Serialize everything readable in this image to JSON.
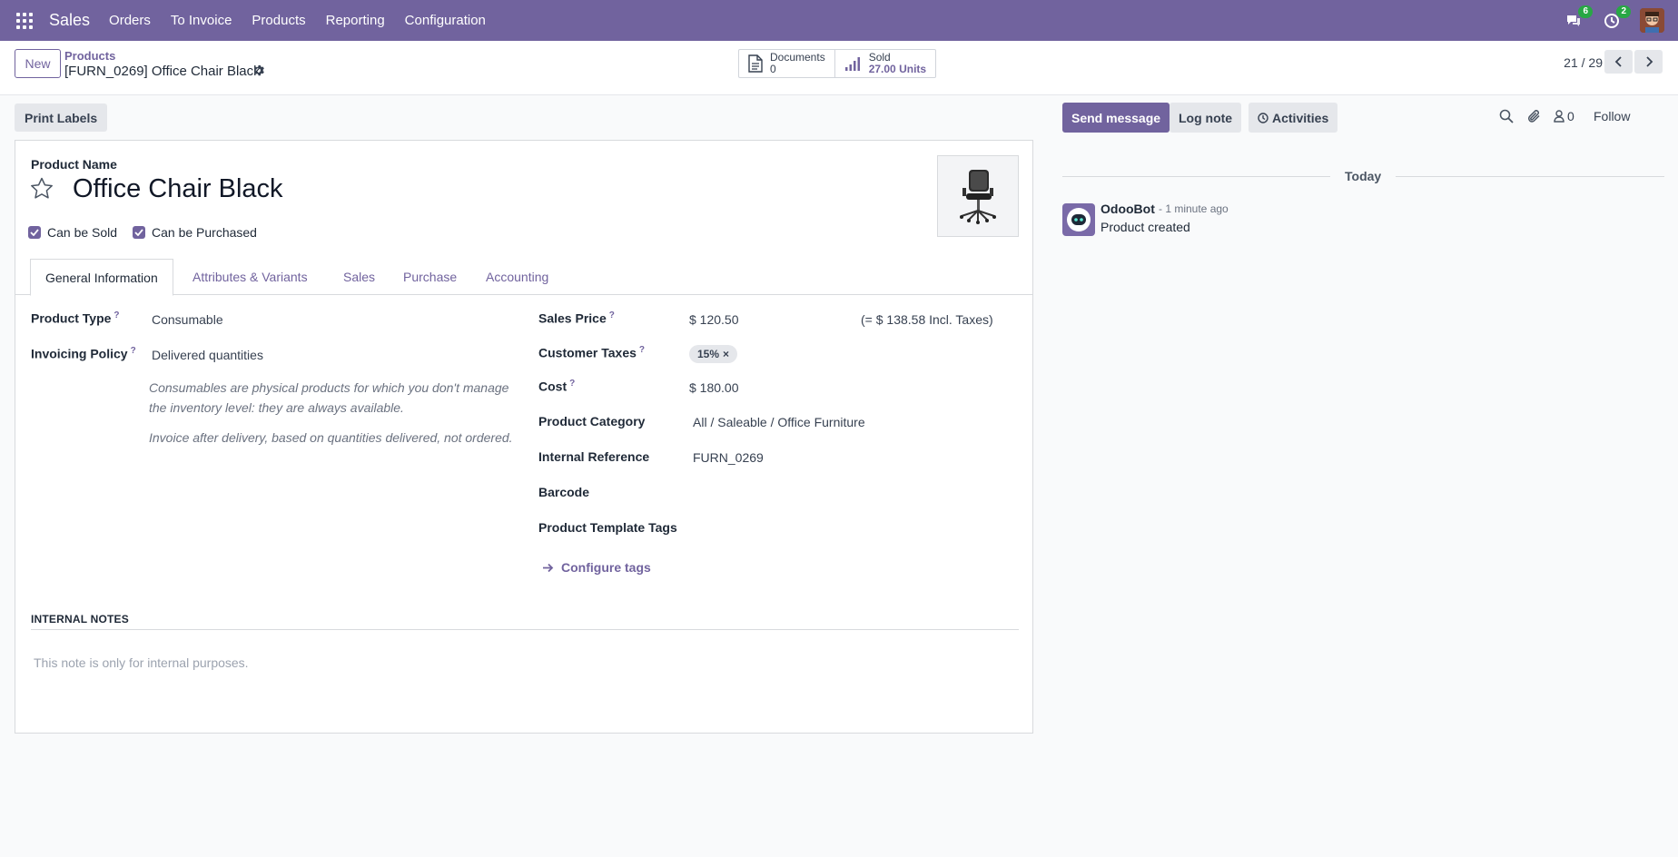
{
  "navbar": {
    "app_name": "Sales",
    "menu": [
      "Orders",
      "To Invoice",
      "Products",
      "Reporting",
      "Configuration"
    ],
    "messages_badge": "6",
    "activities_badge": "2",
    "icons": [
      "apps-grid-icon",
      "chat-icon",
      "clock-icon",
      "user-avatar"
    ],
    "accent_color": "#71639e"
  },
  "control_panel": {
    "new_label": "New",
    "breadcrumb_parent": "Products",
    "breadcrumb_current": "[FURN_0269] Office Chair Black",
    "smart_buttons": {
      "documents_label": "Documents",
      "documents_count": "0",
      "sold_label": "Sold",
      "sold_value": "27.00 Units"
    },
    "pager": "21 / 29"
  },
  "toolbar": {
    "print_labels": "Print Labels"
  },
  "form": {
    "product_name_label": "Product Name",
    "product_name": "Office Chair Black",
    "can_be_sold": "Can be Sold",
    "can_be_purchased": "Can be Purchased",
    "tabs": [
      "General Information",
      "Attributes & Variants",
      "Sales",
      "Purchase",
      "Accounting"
    ],
    "active_tab": "General Information",
    "left": {
      "product_type_label": "Product Type",
      "product_type": "Consumable",
      "invoicing_policy_label": "Invoicing Policy",
      "invoicing_policy": "Delivered quantities",
      "hint_consumable_1": "Consumables are physical products for which you don't manage",
      "hint_consumable_2": "the inventory level: they are always available.",
      "hint_invoice": "Invoice after delivery, based on quantities delivered, not ordered."
    },
    "right": {
      "sales_price_label": "Sales Price",
      "sales_price": "$ 120.50",
      "sales_price_incl": "(= $ 138.58 Incl. Taxes)",
      "customer_taxes_label": "Customer Taxes",
      "customer_tax_tag": "15%",
      "cost_label": "Cost",
      "cost": "$ 180.00",
      "category_label": "Product Category",
      "category": "All / Saleable / Office Furniture",
      "internal_ref_label": "Internal Reference",
      "internal_ref": "FURN_0269",
      "barcode_label": "Barcode",
      "tags_label": "Product Template Tags",
      "configure_tags": "Configure tags"
    },
    "notes_title": "INTERNAL NOTES",
    "notes_placeholder": "This note is only for internal purposes."
  },
  "chatter": {
    "send_message": "Send message",
    "log_note": "Log note",
    "activities": "Activities",
    "followers_count": "0",
    "follow": "Follow",
    "date_separator": "Today",
    "message": {
      "author": "OdooBot",
      "time": "- 1 minute ago",
      "body": "Product created"
    }
  }
}
